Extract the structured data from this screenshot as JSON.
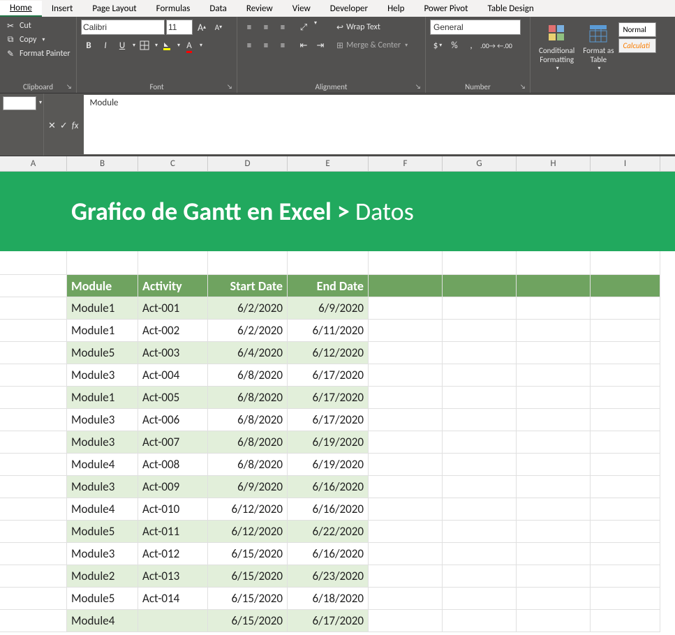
{
  "menu": {
    "items": [
      "Home",
      "Insert",
      "Page Layout",
      "Formulas",
      "Data",
      "Review",
      "View",
      "Developer",
      "Help",
      "Power Pivot",
      "Table Design"
    ],
    "active": "Home"
  },
  "ribbon": {
    "clipboard": {
      "cut": "Cut",
      "copy": "Copy",
      "format_painter": "Format Painter",
      "label": "Clipboard"
    },
    "font": {
      "name": "Calibri",
      "size": "11",
      "increase": "A",
      "decrease": "A",
      "bold": "B",
      "italic": "I",
      "underline": "U",
      "label": "Font"
    },
    "alignment": {
      "wrap": "Wrap Text",
      "merge": "Merge & Center",
      "label": "Alignment"
    },
    "number": {
      "format": "General",
      "label": "Number"
    },
    "styles": {
      "cond_fmt": "Conditional\nFormatting",
      "fmt_table": "Format as\nTable",
      "normal": "Normal",
      "calc": "Calculati"
    }
  },
  "formula_bar": {
    "fx": "fx",
    "value": "Module"
  },
  "columns": [
    "A",
    "B",
    "C",
    "D",
    "E",
    "F",
    "G",
    "H",
    "I"
  ],
  "banner": {
    "title_main": "Grafico de Gantt en Excel ",
    "title_gt": "> ",
    "title_sub": "Datos"
  },
  "table": {
    "headers": [
      "Module",
      "Activity",
      "Start Date",
      "End Date"
    ],
    "rows": [
      [
        "Module1",
        "Act-001",
        "6/2/2020",
        "6/9/2020"
      ],
      [
        "Module1",
        "Act-002",
        "6/2/2020",
        "6/11/2020"
      ],
      [
        "Module5",
        "Act-003",
        "6/4/2020",
        "6/12/2020"
      ],
      [
        "Module3",
        "Act-004",
        "6/8/2020",
        "6/17/2020"
      ],
      [
        "Module1",
        "Act-005",
        "6/8/2020",
        "6/17/2020"
      ],
      [
        "Module3",
        "Act-006",
        "6/8/2020",
        "6/17/2020"
      ],
      [
        "Module3",
        "Act-007",
        "6/8/2020",
        "6/19/2020"
      ],
      [
        "Module4",
        "Act-008",
        "6/8/2020",
        "6/19/2020"
      ],
      [
        "Module3",
        "Act-009",
        "6/9/2020",
        "6/16/2020"
      ],
      [
        "Module4",
        "Act-010",
        "6/12/2020",
        "6/16/2020"
      ],
      [
        "Module5",
        "Act-011",
        "6/12/2020",
        "6/22/2020"
      ],
      [
        "Module3",
        "Act-012",
        "6/15/2020",
        "6/16/2020"
      ],
      [
        "Module2",
        "Act-013",
        "6/15/2020",
        "6/23/2020"
      ],
      [
        "Module5",
        "Act-014",
        "6/15/2020",
        "6/18/2020"
      ],
      [
        "Module4",
        "",
        "6/15/2020",
        "6/17/2020"
      ]
    ]
  }
}
